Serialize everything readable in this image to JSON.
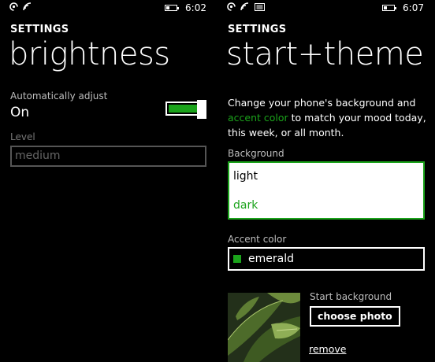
{
  "left": {
    "status": {
      "time": "6:02"
    },
    "app_title": "SETTINGS",
    "page_title": "brightness",
    "auto_adjust": {
      "label": "Automatically adjust",
      "value": "On",
      "on": true
    },
    "level": {
      "label": "Level",
      "value": "medium"
    }
  },
  "right": {
    "status": {
      "time": "6:07"
    },
    "app_title": "SETTINGS",
    "page_title": "start+theme",
    "description": {
      "part1": "Change your phone's background and ",
      "link": "accent color",
      "part2": " to match your mood today, this week, or all month."
    },
    "background": {
      "label": "Background",
      "options": [
        "light",
        "dark"
      ],
      "selected": "dark"
    },
    "accent": {
      "label": "Accent color",
      "value": "emerald",
      "color": "#1ba31b"
    },
    "start_background": {
      "label": "Start background",
      "choose_label": "choose photo",
      "remove_label": "remove"
    }
  },
  "colors": {
    "accent": "#1ba31b",
    "background": "#000000",
    "foreground": "#ffffff"
  }
}
